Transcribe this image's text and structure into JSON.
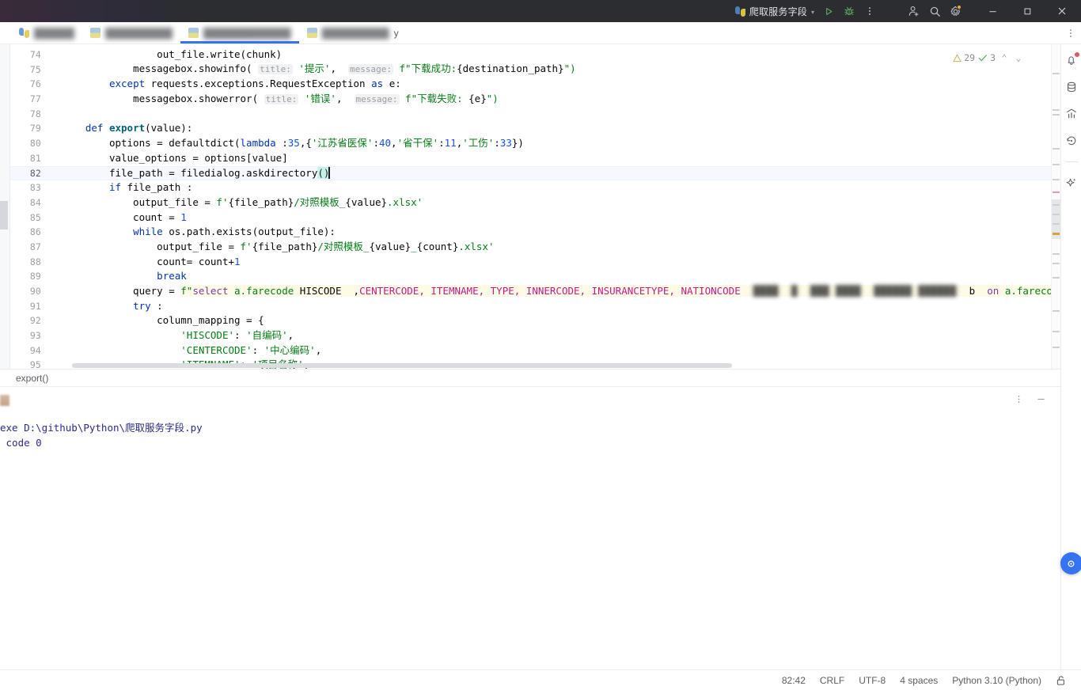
{
  "titlebar": {
    "run_config_name": "爬取服务字段",
    "dropdown_caret": "▾",
    "icons": {
      "run": "run-play-icon",
      "debug": "debug-bug-icon",
      "more": "more-vertical-icon",
      "account": "user-add-icon",
      "search": "search-icon",
      "settings": "settings-gear-icon",
      "minimize": "minimize-icon",
      "maximize": "maximize-icon",
      "close": "close-icon"
    },
    "minimize_label": "—",
    "maximize_label": "❐",
    "close_label": "✕"
  },
  "tabs": [
    {
      "label": "██████",
      "icon": "python-file-icon",
      "active": false,
      "suffix": ""
    },
    {
      "label": "██████████",
      "icon": "file-icon",
      "active": false,
      "suffix": ""
    },
    {
      "label": "█████████████",
      "icon": "file-icon",
      "active": true,
      "suffix": ""
    },
    {
      "label": "██████████",
      "icon": "file-icon",
      "active": false,
      "suffix": "y"
    }
  ],
  "tabbar": {
    "kebab": "⋮"
  },
  "inspections": {
    "warning_count": "29",
    "ok_count": "3",
    "prev_caret": "⌃",
    "next_caret": "⌄",
    "warning_icon": "warning-triangle-icon",
    "ok_icon": "check-mark-icon"
  },
  "editor": {
    "lines": [
      {
        "no": "74",
        "text": "                out_file.write(chunk)"
      },
      {
        "no": "75",
        "text": "            messagebox.showinfo( title: '提示',   message: f\"下载成功:{destination_path}\")"
      },
      {
        "no": "76",
        "text": "        except requests.exceptions.RequestException as e:"
      },
      {
        "no": "77",
        "text": "            messagebox.showerror( title: '错误',   message: f\"下载失败: {e}\")"
      },
      {
        "no": "78",
        "text": ""
      },
      {
        "no": "79",
        "text": "    def export(value):"
      },
      {
        "no": "80",
        "text": "        options = defaultdict(lambda :35,{'江苏省医保':40,'省干保':11,'工伤':33})"
      },
      {
        "no": "81",
        "text": "        value_options = options[value]"
      },
      {
        "no": "82",
        "text": "        file_path = filedialog.askdirectory()"
      },
      {
        "no": "83",
        "text": "        if file_path :"
      },
      {
        "no": "84",
        "text": "            output_file = f'{file_path}/对照模板_{value}.xlsx'"
      },
      {
        "no": "85",
        "text": "            count = 1"
      },
      {
        "no": "86",
        "text": "            while os.path.exists(output_file):"
      },
      {
        "no": "87",
        "text": "                output_file = f'{file_path}/对照模板_{value}_{count}.xlsx'"
      },
      {
        "no": "88",
        "text": "                count= count+1"
      },
      {
        "no": "89",
        "text": "                break"
      },
      {
        "no": "90",
        "text": "            query = f\"select a.farecode HISCODE  ,CENTERCODE, ITEMNAME, TYPE, INNERCODE, INSURANCETYPE, NATIONCODE  ██████  b  on a.farecode = b.hiscode where"
      },
      {
        "no": "91",
        "text": "            try :"
      },
      {
        "no": "92",
        "text": "                column_mapping = {"
      },
      {
        "no": "93",
        "text": "                    'HISCODE': '自编码',"
      },
      {
        "no": "94",
        "text": "                    'CENTERCODE': '中心编码',"
      },
      {
        "no": "95",
        "text": "                    'ITEMNAME': '项目名称',"
      }
    ],
    "current_line_no": "82",
    "hint_title": "title:",
    "hint_message": "message:"
  },
  "breadcrumb": {
    "path": "export()"
  },
  "console": {
    "header_icons": {
      "more": "⋮",
      "hide": "—"
    },
    "lines": [
      "exe D:\\github\\Python\\爬取服务字段.py",
      "",
      " code 0"
    ]
  },
  "rightbar": {
    "items": [
      {
        "name": "notifications-icon",
        "badge": true
      },
      {
        "name": "database-icon",
        "badge": false
      },
      {
        "name": "analytics-chart-icon",
        "badge": false
      },
      {
        "name": "history-icon",
        "badge": false
      },
      {
        "name": "ai-assistant-sparkle-icon",
        "badge": false
      }
    ],
    "fab": {
      "name": "ai-chat-fab",
      "glyph": "◉"
    }
  },
  "statusbar": {
    "items": [
      {
        "label": "82:42",
        "name": "caret-position"
      },
      {
        "label": "CRLF",
        "name": "line-separator"
      },
      {
        "label": "UTF-8",
        "name": "file-encoding"
      },
      {
        "label": "4 spaces",
        "name": "indent-setting"
      },
      {
        "label": "Python 3.10 (Python)",
        "name": "interpreter-selector"
      }
    ],
    "lock_icon": "unlocked-padlock-icon"
  },
  "colors": {
    "titlebar_bg": "#2b2d30",
    "accent_blue": "#3574f0",
    "keyword": "#0033b3",
    "string": "#067d17",
    "number": "#1750eb",
    "function": "#00627a",
    "sql_highlight": "#fdfbe6",
    "badge_orange": "#f2a33c",
    "notification_red": "#e55765"
  }
}
